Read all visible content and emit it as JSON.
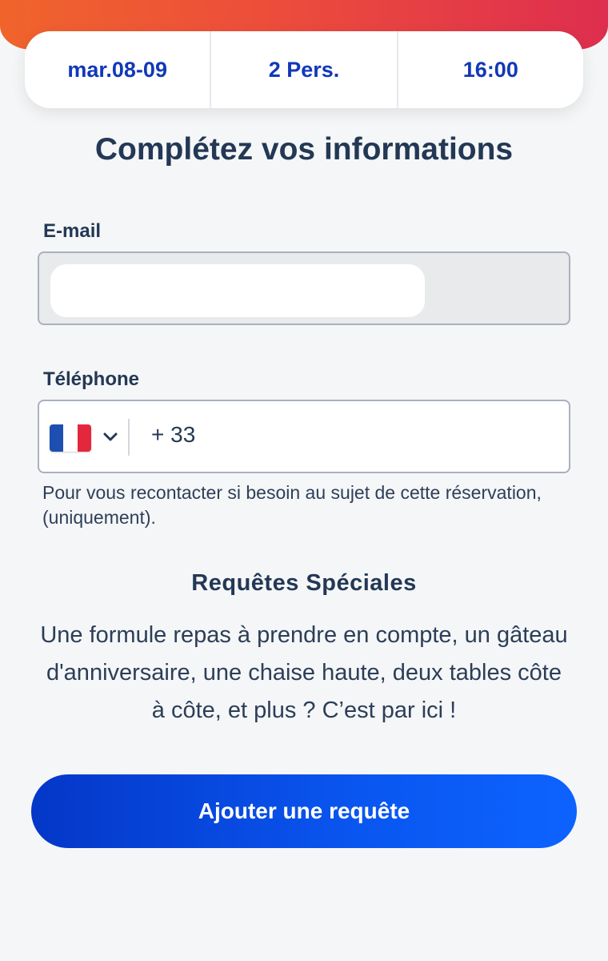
{
  "summary": {
    "date": "mar.08-09",
    "guests": "2 Pers.",
    "time": "16:00"
  },
  "form": {
    "title": "Complétez vos informations",
    "email_label": "E-mail",
    "phone_label": "Téléphone",
    "phone_country_icon": "france-flag-icon",
    "phone_prefix": "+ 33",
    "phone_help": "Pour vous recontacter si besoin au sujet de cette réservation, (uniquement)."
  },
  "special_requests": {
    "title": "Requêtes Spéciales",
    "description": "Une formule repas à prendre en compte, un gâteau d'anniversaire, une chaise haute, deux tables côte à côte, et plus ? C’est par ici !",
    "button_label": "Ajouter une requête"
  },
  "colors": {
    "accent_blue": "#1238b8",
    "button_blue": "#0a56f0",
    "header_gradient_start": "#f0642c",
    "header_gradient_end": "#de2e4f",
    "text_dark": "#233855"
  }
}
